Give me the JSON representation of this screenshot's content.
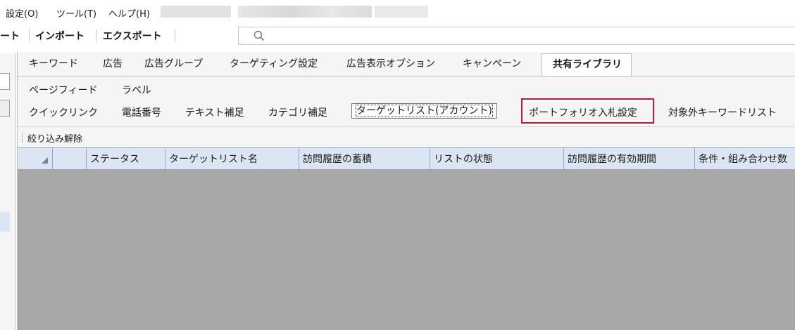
{
  "menu": {
    "items": [
      "設定(O)",
      "ツール(T)",
      "ヘルプ(H)"
    ]
  },
  "toolbar": {
    "items": [
      "ート",
      "インポート",
      "エクスポート"
    ]
  },
  "search": {
    "icon": "search-icon",
    "placeholder": ""
  },
  "main_tabs": [
    "キーワード",
    "広告",
    "広告グループ",
    "ターゲティング設定",
    "広告表示オプション",
    "キャンペーン",
    "共有ライブラリ"
  ],
  "sub_tabs_row1": [
    "ページフィード",
    "ラベル"
  ],
  "sub_tabs_row2": [
    "クイックリンク",
    "電話番号",
    "テキスト補足",
    "カテゴリ補足",
    "ターゲットリスト(アカウント)",
    "ポートフォリオ入札設定",
    "対象外キーワードリスト"
  ],
  "filter": {
    "clear_label": "絞り込み解除"
  },
  "table": {
    "headers": [
      "",
      "",
      "ステータス",
      "ターゲットリスト名",
      "訪問履歴の蓄積",
      "リストの状態",
      "訪問履歴の有効期間",
      "条件・組み合わせ数"
    ],
    "rows": []
  },
  "colors": {
    "highlight": "#c21a32",
    "header_bg": "#dce6f2",
    "body_bg": "#a8a8a8"
  }
}
